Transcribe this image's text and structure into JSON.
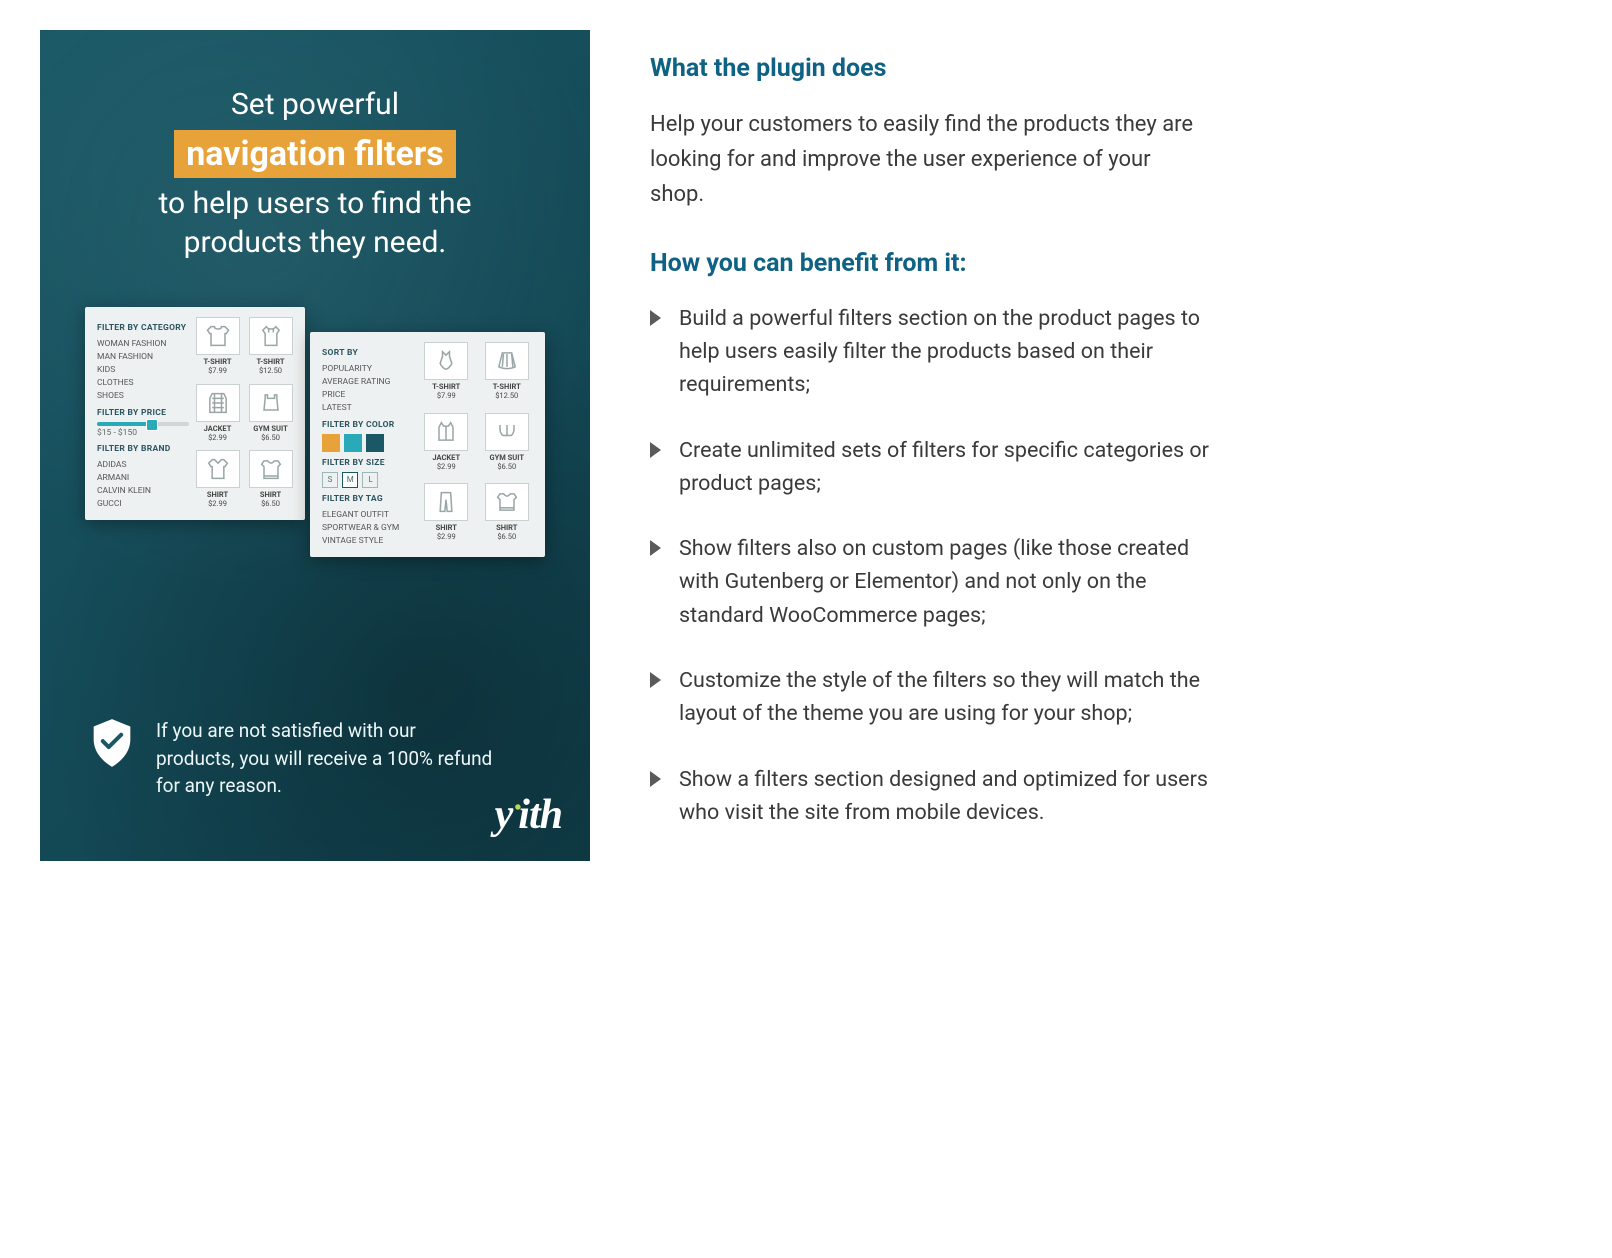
{
  "promo": {
    "headline_pre": "Set powerful",
    "headline_highlight": "navigation filters",
    "headline_post_1": "to help users to find the",
    "headline_post_2": "products they need.",
    "refund_text": "If you are not satisfied with our products, you will receive a 100% refund for any reason.",
    "logo": "yith"
  },
  "mockup": {
    "card1": {
      "cat_title": "FILTER BY CATEGORY",
      "cats": [
        "WOMAN FASHION",
        "MAN FASHION",
        "KIDS",
        "CLOTHES",
        "SHOES"
      ],
      "price_title": "FILTER BY PRICE",
      "price_range": "$15 - $150",
      "brand_title": "FILTER BY BRAND",
      "brands": [
        "ADIDAS",
        "ARMANI",
        "CALVIN KLEIN",
        "GUCCI"
      ],
      "products": [
        {
          "name": "T-SHIRT",
          "price": "$7.99"
        },
        {
          "name": "T-SHIRT",
          "price": "$12.50"
        },
        {
          "name": "JACKET",
          "price": "$2.99"
        },
        {
          "name": "GYM SUIT",
          "price": "$6.50"
        },
        {
          "name": "SHIRT",
          "price": "$2.99"
        },
        {
          "name": "SHIRT",
          "price": "$6.50"
        }
      ]
    },
    "card2": {
      "sort_title": "SORT BY",
      "sorts": [
        "POPULARITY",
        "AVERAGE RATING",
        "PRICE",
        "LATEST"
      ],
      "color_title": "FILTER BY COLOR",
      "size_title": "FILTER BY SIZE",
      "sizes": [
        "S",
        "M",
        "L"
      ],
      "tag_title": "FILTER BY TAG",
      "tags": [
        "ELEGANT OUTFIT",
        "SPORTWEAR & GYM",
        "VINTAGE STYLE"
      ],
      "products": [
        {
          "name": "T-SHIRT",
          "price": "$7.99"
        },
        {
          "name": "T-SHIRT",
          "price": "$12.50"
        },
        {
          "name": "JACKET",
          "price": "$2.99"
        },
        {
          "name": "GYM SUIT",
          "price": "$6.50"
        },
        {
          "name": "SHIRT",
          "price": "$2.99"
        },
        {
          "name": "SHIRT",
          "price": "$6.50"
        }
      ]
    }
  },
  "content": {
    "heading_does": "What the plugin does",
    "lead": "Help your customers to easily find the products they are looking for and improve the user experience of your shop.",
    "heading_benefit": "How you can benefit from it:",
    "benefits": [
      "Build a powerful filters section on the product pages to help users easily filter the products based on their requirements;",
      "Create unlimited sets of filters for specific categories or product pages;",
      "Show filters also on custom pages (like those created with Gutenberg or Elementor) and not only on the standard WooCommerce pages;",
      "Customize the style of the filters so they will match the layout of the theme you are using for your shop;",
      "Show a filters section designed and optimized for users who visit the site from mobile devices."
    ]
  }
}
